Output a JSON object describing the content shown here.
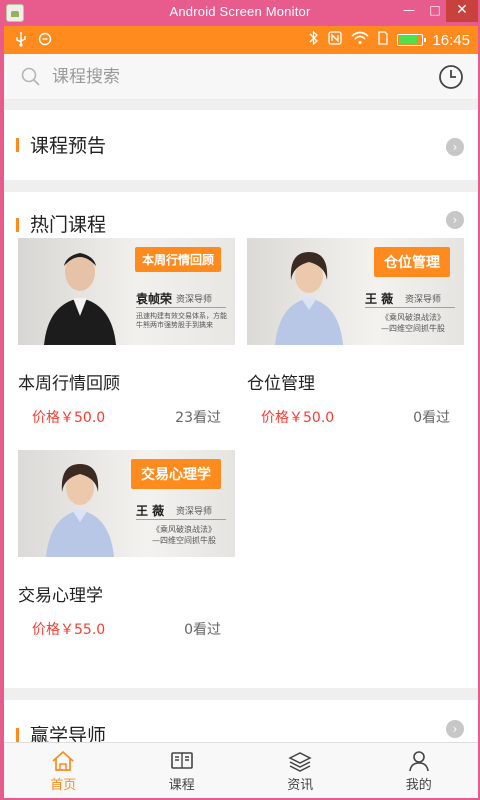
{
  "window": {
    "title": "Android Screen Monitor",
    "minimize": "—",
    "maximize": "□",
    "close": "✕"
  },
  "status_bar": {
    "time": "16:45",
    "left_icons": [
      "usb-icon",
      "notification-icon"
    ],
    "right_icons": [
      "bluetooth-icon",
      "nfc-icon",
      "wifi-icon",
      "sim-icon",
      "battery-icon"
    ]
  },
  "search": {
    "placeholder": "课程搜索"
  },
  "sections": {
    "preview": {
      "title": "课程预告"
    },
    "hot": {
      "title": "热门课程"
    },
    "teachers": {
      "title": "赢学导师"
    }
  },
  "courses": [
    {
      "title": "本周行情回顾",
      "price": "价格￥50.0",
      "views": "23看过",
      "thumb": {
        "tag": "本周行情回顾",
        "name": "袁帧荣",
        "role": "资深导师",
        "desc": "迅速构建有效交易体系，方能牛熊两市强势股手到擒来"
      }
    },
    {
      "title": "仓位管理",
      "price": "价格￥50.0",
      "views": "0看过",
      "thumb": {
        "tag": "仓位管理",
        "name": "王  薇",
        "role": "资深导师",
        "desc": "《乘风破浪战法》\n—四维空间抓牛股"
      }
    },
    {
      "title": "交易心理学",
      "price": "价格￥55.0",
      "views": "0看过",
      "thumb": {
        "tag": "交易心理学",
        "name": "王  薇",
        "role": "资深导师",
        "desc": "《乘风破浪战法》\n—四维空间抓牛股"
      }
    }
  ],
  "tabs": [
    {
      "label": "首页",
      "icon": "home-icon",
      "active": true
    },
    {
      "label": "课程",
      "icon": "course-icon",
      "active": false
    },
    {
      "label": "资讯",
      "icon": "news-icon",
      "active": false
    },
    {
      "label": "我的",
      "icon": "profile-icon",
      "active": false
    }
  ],
  "colors": {
    "accent": "#ff8b1e",
    "price": "#ff3b30",
    "window_frame": "#e75c8c"
  }
}
